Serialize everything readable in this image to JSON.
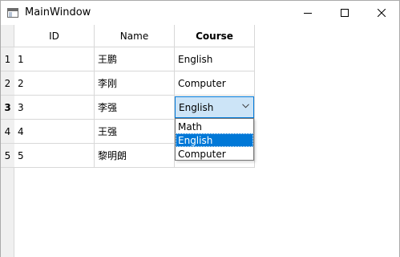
{
  "window": {
    "title": "MainWindow",
    "icon": "app-window-icon",
    "controls": [
      "minimize-icon",
      "maximize-icon",
      "close-icon"
    ]
  },
  "table": {
    "columns": [
      "ID",
      "Name",
      "Course"
    ],
    "row_headers": [
      "1",
      "2",
      "3",
      "4",
      "5"
    ],
    "current_row": 3,
    "rows": [
      {
        "id": "1",
        "name": " 王鹏",
        "course": "English"
      },
      {
        "id": "2",
        "name": "李刚",
        "course": "Computer"
      },
      {
        "id": "3",
        "name": "李强",
        "course": "English"
      },
      {
        "id": "4",
        "name": "王强",
        "course": ""
      },
      {
        "id": "5",
        "name": "黎明朗",
        "course": ""
      }
    ]
  },
  "editor": {
    "value": "English",
    "options": [
      "Math",
      "English",
      "Computer"
    ],
    "highlighted": "English"
  }
}
